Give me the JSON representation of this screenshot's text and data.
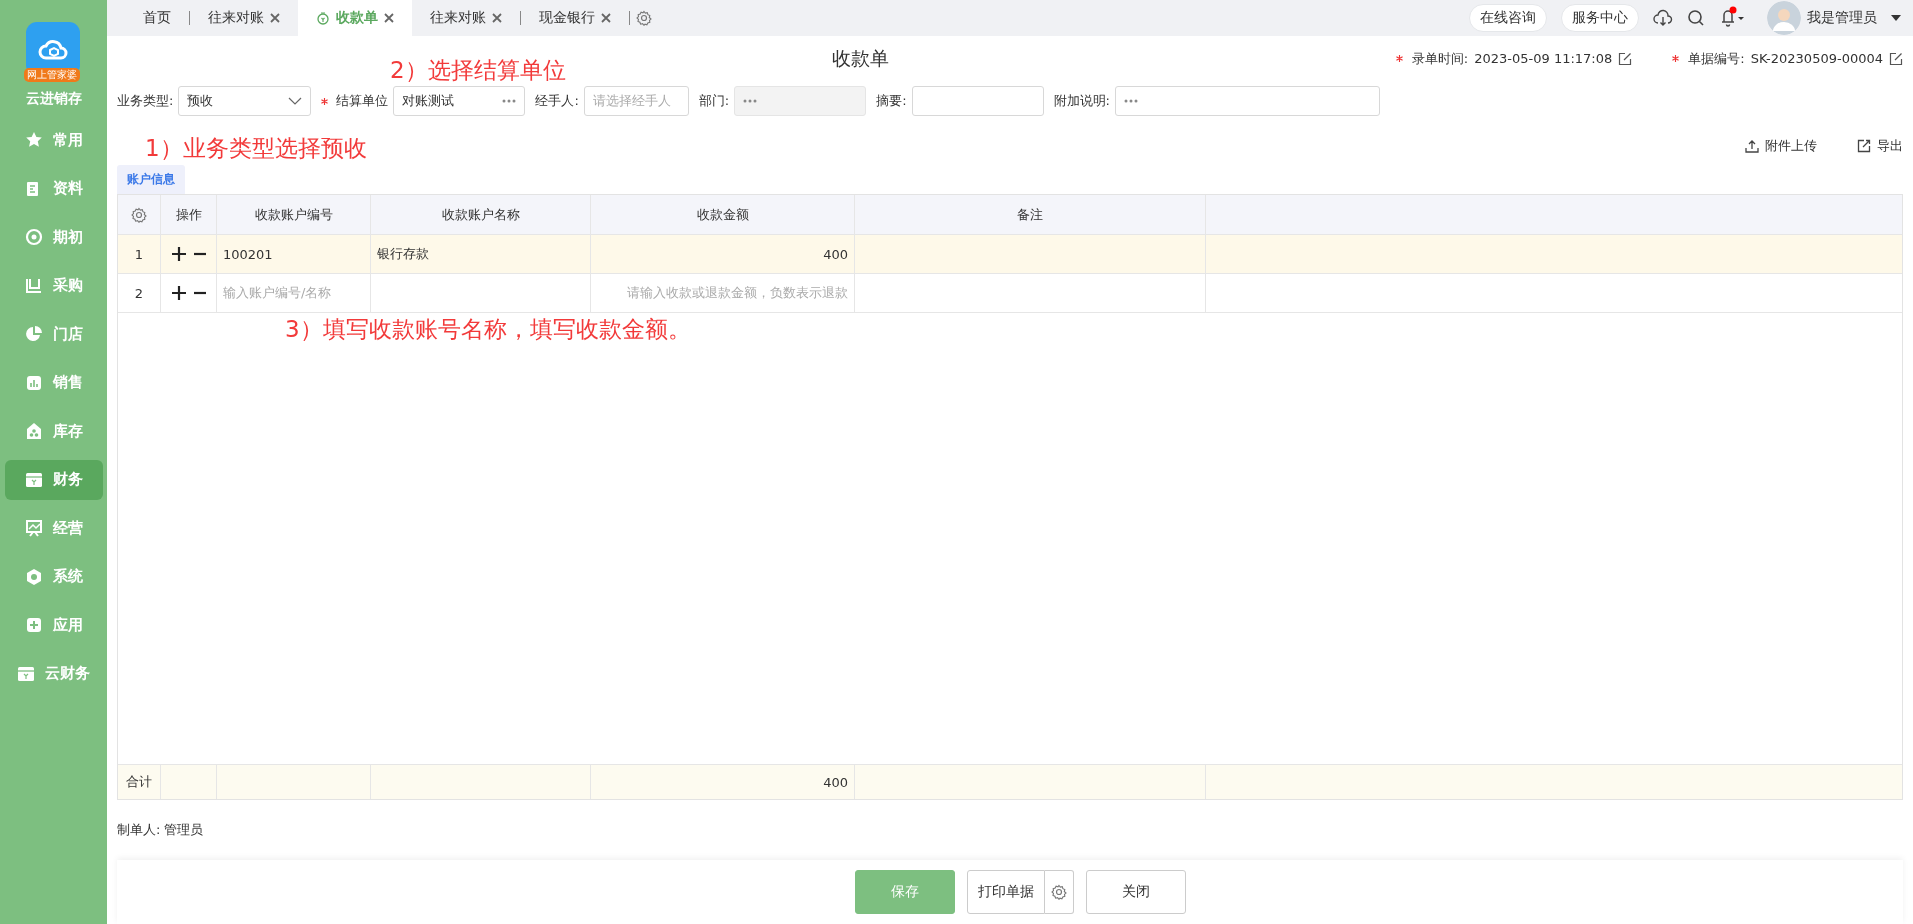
{
  "app": {
    "name": "云进销存",
    "logo_badge": "网上管家婆"
  },
  "sidebar": {
    "items": [
      {
        "label": "常用",
        "selected": false
      },
      {
        "label": "资料",
        "selected": false
      },
      {
        "label": "期初",
        "selected": false
      },
      {
        "label": "采购",
        "selected": false
      },
      {
        "label": "门店",
        "selected": false
      },
      {
        "label": "销售",
        "selected": false
      },
      {
        "label": "库存",
        "selected": false
      },
      {
        "label": "财务",
        "selected": true
      },
      {
        "label": "经营",
        "selected": false
      },
      {
        "label": "系统",
        "selected": false
      },
      {
        "label": "应用",
        "selected": false
      },
      {
        "label": "云财务",
        "selected": false
      }
    ]
  },
  "tabs": [
    {
      "label": "首页",
      "selected": false,
      "closable": false
    },
    {
      "label": "往来对账",
      "selected": false,
      "closable": true
    },
    {
      "label": "收款单",
      "selected": true,
      "closable": true
    },
    {
      "label": "往来对账",
      "selected": false,
      "closable": true
    },
    {
      "label": "现金银行",
      "selected": false,
      "closable": true
    }
  ],
  "header_links": [
    "在线咨询",
    "服务中心"
  ],
  "user": {
    "name": "我是管理员",
    "notification": true
  },
  "form": {
    "title": "收款单",
    "meta": [
      {
        "label": "录单时间:",
        "value": "2023-05-09 11:17:08",
        "required": true
      },
      {
        "label": "单据编号:",
        "value": "SK-20230509-00004",
        "required": true
      }
    ],
    "fields": [
      {
        "label": "业务类型:",
        "kind": "select",
        "required": false,
        "value": "预收",
        "disabled": false
      },
      {
        "label": "结算单位",
        "kind": "picker",
        "required": true,
        "value": "对账测试",
        "disabled": false
      },
      {
        "label": "经手人:",
        "kind": "text",
        "required": false,
        "placeholder": "请选择经手人",
        "disabled": false
      },
      {
        "label": "部门:",
        "kind": "picker",
        "required": false,
        "disabled": true
      },
      {
        "label": "摘要:",
        "kind": "text",
        "required": false,
        "disabled": false
      },
      {
        "label": "附加说明:",
        "kind": "picker",
        "required": false,
        "disabled": false
      }
    ],
    "actions": [
      "附件上传",
      "导出"
    ]
  },
  "annotations": [
    "1）业务类型选择预收",
    "2）选择结算单位",
    "3）填写收款账号名称，填写收款金额。"
  ],
  "section_tab": {
    "label": "账户信息",
    "selected": true
  },
  "table": {
    "columns": [
      "操作",
      "收款账户编号",
      "收款账户名称",
      "收款金额",
      "备注"
    ],
    "rows": [
      {
        "index": "1",
        "account_code": "100201",
        "account_name": "银行存款",
        "amount": "400",
        "selected": true
      },
      {
        "index": "2",
        "account_code_placeholder": "输入账户编号/名称",
        "amount_placeholder": "请输入收款或退款金额，负数表示退款",
        "selected": false
      }
    ],
    "total": {
      "label": "合计",
      "amount": "400"
    }
  },
  "creator": {
    "label": "制单人:",
    "value": "管理员"
  },
  "buttons": [
    {
      "label": "保存",
      "kind": "primary"
    },
    {
      "label": "打印单据",
      "kind": "split"
    },
    {
      "label": "关闭",
      "kind": "default"
    }
  ]
}
